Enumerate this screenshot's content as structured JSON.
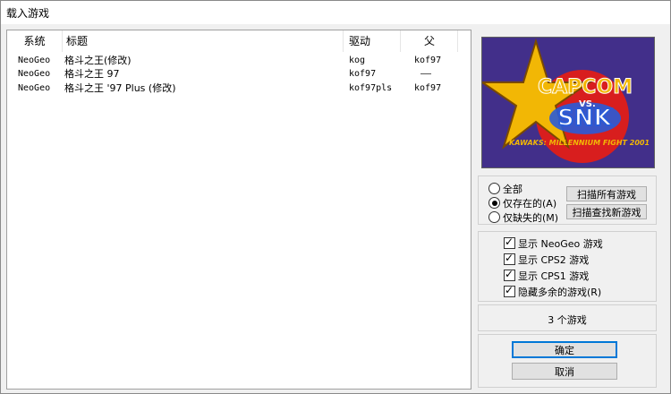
{
  "window": {
    "title": "载入游戏"
  },
  "table": {
    "columns": [
      "系统",
      "标题",
      "驱动",
      "父"
    ],
    "rows": [
      {
        "system": "NeoGeo",
        "title": "格斗之王(修改)",
        "driver": "kog",
        "parent": "kof97"
      },
      {
        "system": "NeoGeo",
        "title": "格斗之王 97",
        "driver": "kof97",
        "parent": "——"
      },
      {
        "system": "NeoGeo",
        "title": "格斗之王 '97 Plus (修改)",
        "driver": "kof97pls",
        "parent": "kof97"
      }
    ]
  },
  "preview": {
    "logo_top": "CAPCOM",
    "logo_vs": "VS.",
    "logo_main": "SNK",
    "logo_sub": "KAWAKS: MILLENNIUM FIGHT 2001",
    "colors": {
      "bg": "#3a2a80",
      "star": "#f2b705",
      "red": "#d81e1e",
      "blue": "#2a5bd7"
    }
  },
  "filter": {
    "options": [
      {
        "label": "全部",
        "checked": false
      },
      {
        "label": "仅存在的(A)",
        "checked": true
      },
      {
        "label": "仅缺失的(M)",
        "checked": false
      }
    ],
    "scan_all": "扫描所有游戏",
    "scan_new": "扫描查找新游戏"
  },
  "checks": [
    {
      "label": "显示 NeoGeo 游戏",
      "checked": true
    },
    {
      "label": "显示 CPS2 游戏",
      "checked": true
    },
    {
      "label": "显示 CPS1 游戏",
      "checked": true
    },
    {
      "label": "隐藏多余的游戏(R)",
      "checked": true
    }
  ],
  "count": "3 个游戏",
  "buttons": {
    "ok": "确定",
    "cancel": "取消"
  }
}
